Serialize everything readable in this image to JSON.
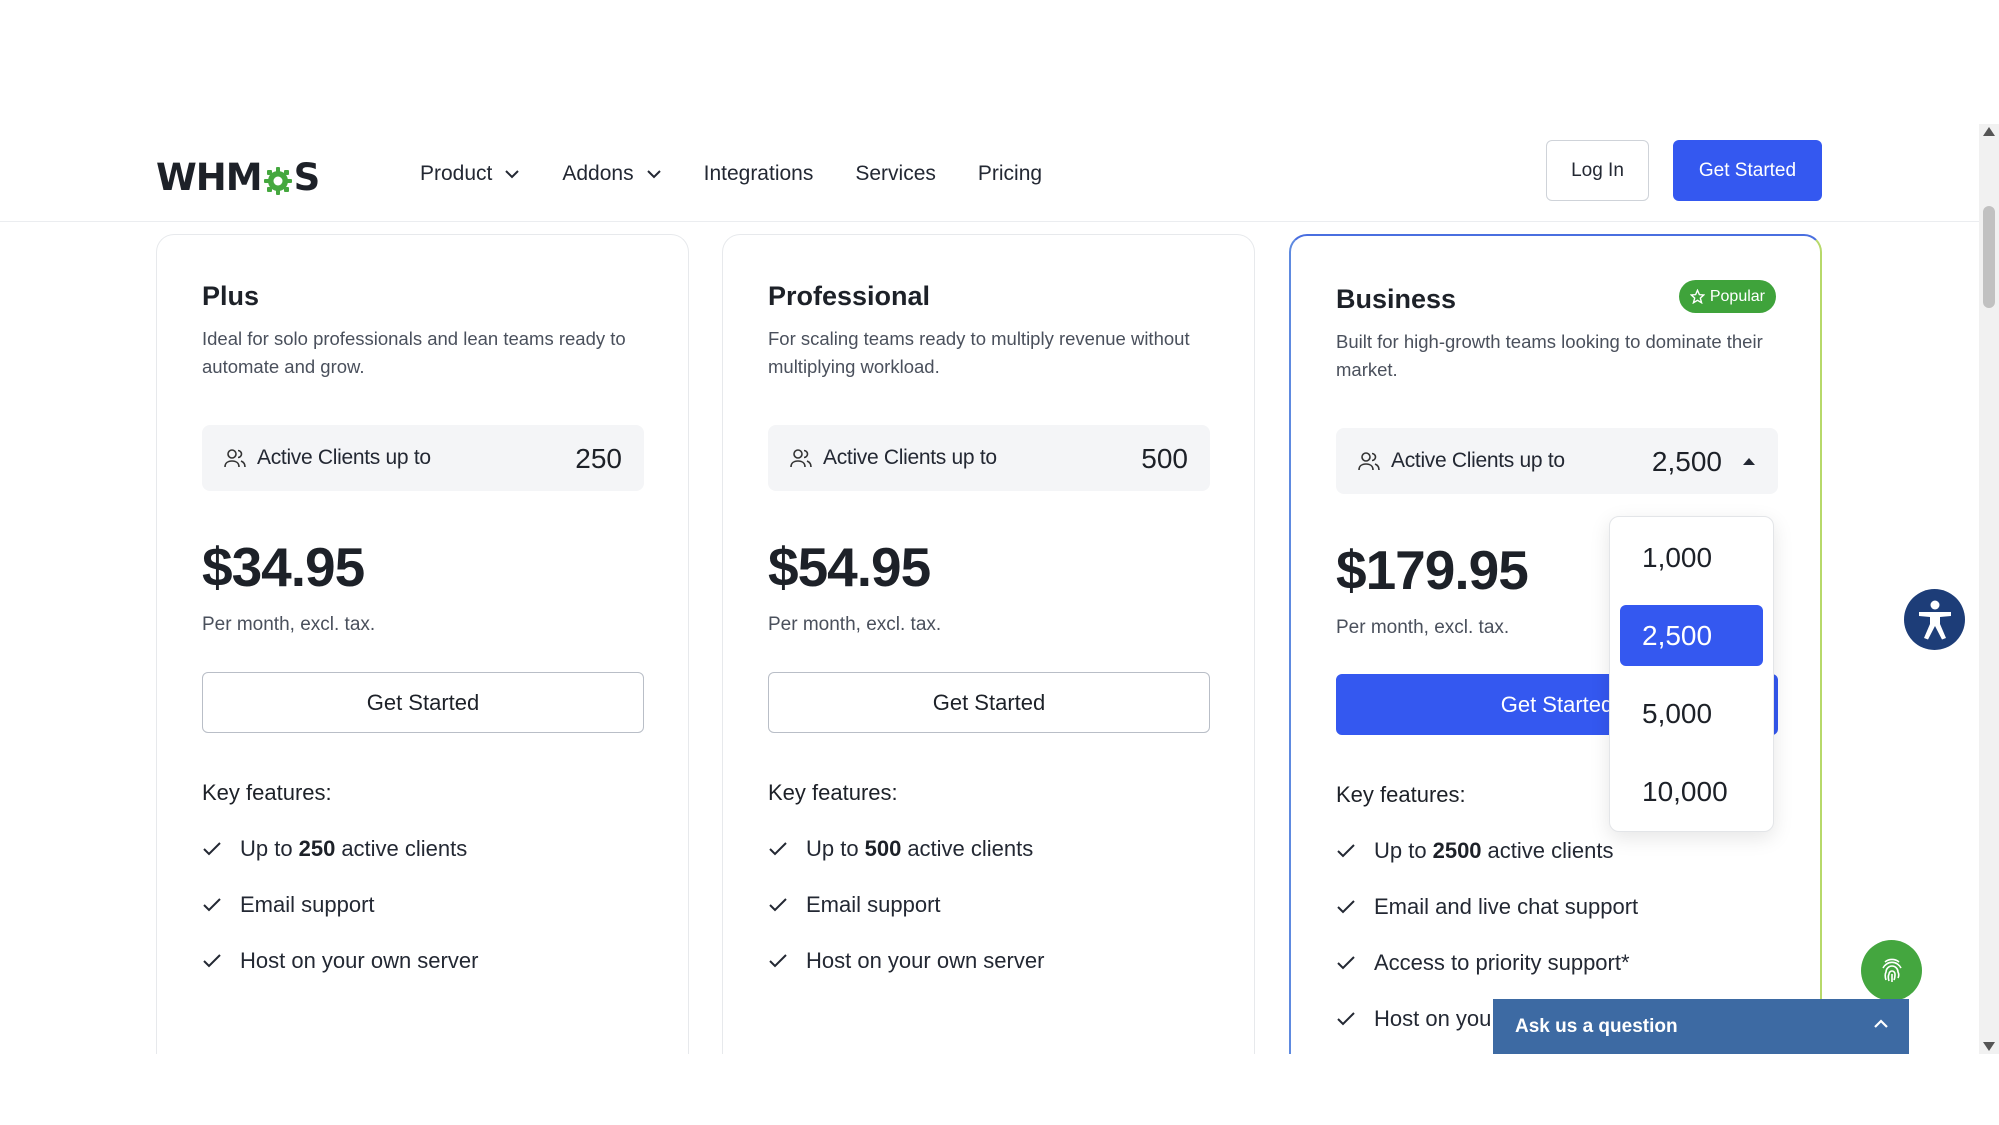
{
  "header": {
    "logo_text_left": "WHM",
    "logo_text_right": "S",
    "nav": [
      {
        "label": "Product",
        "has_dropdown": true
      },
      {
        "label": "Addons",
        "has_dropdown": true
      },
      {
        "label": "Integrations",
        "has_dropdown": false
      },
      {
        "label": "Services",
        "has_dropdown": false
      },
      {
        "label": "Pricing",
        "has_dropdown": false
      }
    ],
    "login_label": "Log In",
    "get_started_label": "Get Started"
  },
  "plans": [
    {
      "name": "Plus",
      "description": "Ideal for solo professionals and lean teams ready to automate and grow.",
      "clients_label": "Active Clients up to",
      "clients_value": "250",
      "price": "$34.95",
      "price_note": "Per month, excl. tax.",
      "cta": "Get Started",
      "features_title": "Key features:",
      "features": [
        {
          "prefix": "Up to",
          "bold": "250",
          "suffix": "active clients"
        },
        {
          "prefix": "Email support",
          "bold": "",
          "suffix": ""
        },
        {
          "prefix": "Host on your own server",
          "bold": "",
          "suffix": ""
        }
      ]
    },
    {
      "name": "Professional",
      "description": "For scaling teams ready to multiply revenue without multiplying workload.",
      "clients_label": "Active Clients up to",
      "clients_value": "500",
      "price": "$54.95",
      "price_note": "Per month, excl. tax.",
      "cta": "Get Started",
      "features_title": "Key features:",
      "features": [
        {
          "prefix": "Up to",
          "bold": "500",
          "suffix": "active clients"
        },
        {
          "prefix": "Email support",
          "bold": "",
          "suffix": ""
        },
        {
          "prefix": "Host on your own server",
          "bold": "",
          "suffix": ""
        }
      ]
    },
    {
      "name": "Business",
      "badge": "Popular",
      "description": "Built for high-growth teams looking to dominate their market.",
      "clients_label": "Active Clients up to",
      "clients_value": "2,500",
      "price": "$179.95",
      "price_note": "Per month, excl. tax.",
      "cta": "Get Started",
      "features_title": "Key features:",
      "features": [
        {
          "prefix": "Up to",
          "bold": "2500",
          "suffix": "active clients"
        },
        {
          "prefix": "Email and live chat support",
          "bold": "",
          "suffix": ""
        },
        {
          "prefix": "Access to priority support*",
          "bold": "",
          "suffix": ""
        },
        {
          "prefix": "Host on you",
          "bold": "",
          "suffix": ""
        }
      ]
    }
  ],
  "dropdown": {
    "options": [
      "1,000",
      "2,500",
      "5,000",
      "10,000"
    ],
    "selected": "2,500"
  },
  "chat": {
    "label": "Ask us a question"
  },
  "colors": {
    "brand_blue": "#3458f0",
    "popular_green": "#3fa33b",
    "chat_blue": "#3d6aa3",
    "accessibility_navy": "#1d3d78"
  }
}
